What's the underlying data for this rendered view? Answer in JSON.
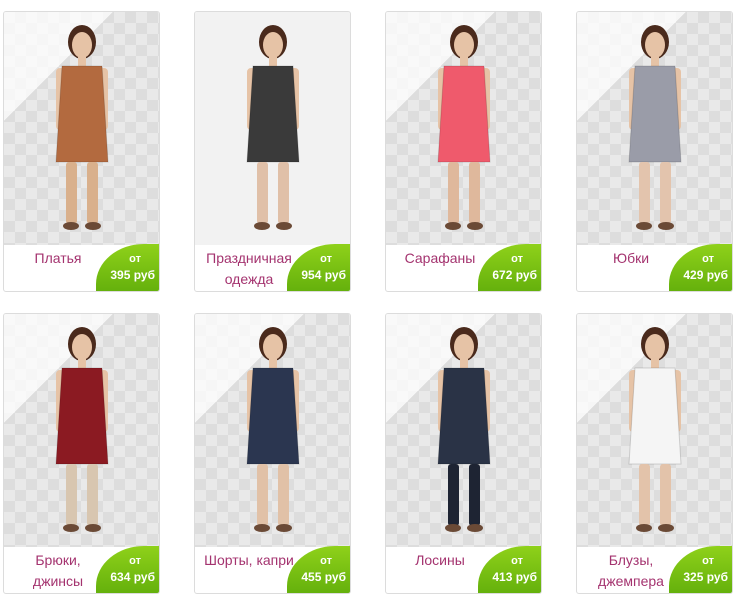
{
  "from_label": "от",
  "categories": [
    {
      "name": "Платья",
      "price": "395 руб",
      "dress": "#b36a3f",
      "legs": "#d9b08c"
    },
    {
      "name": "Праздничная одежда",
      "price": "954 руб",
      "dress": "#3a3a3a",
      "legs": "#e0c0a8"
    },
    {
      "name": "Сарафаны",
      "price": "672 руб",
      "dress": "#ef5a6c",
      "legs": "#dfb89c"
    },
    {
      "name": "Юбки",
      "price": "429 руб",
      "dress": "#9a9ca8",
      "legs": "#e3c4ad"
    },
    {
      "name": "Брюки, джинсы",
      "price": "634 руб",
      "dress": "#8b1a22",
      "legs": "#d8c6b0"
    },
    {
      "name": "Шорты, капри",
      "price": "455 руб",
      "dress": "#2b3650",
      "legs": "#e1c1a7"
    },
    {
      "name": "Лосины",
      "price": "413 руб",
      "dress": "#2a3346",
      "legs": "#1e2433"
    },
    {
      "name": "Блузы, джемпера",
      "price": "325 руб",
      "dress": "#f5f5f5",
      "legs": "#e3c3aa"
    }
  ]
}
